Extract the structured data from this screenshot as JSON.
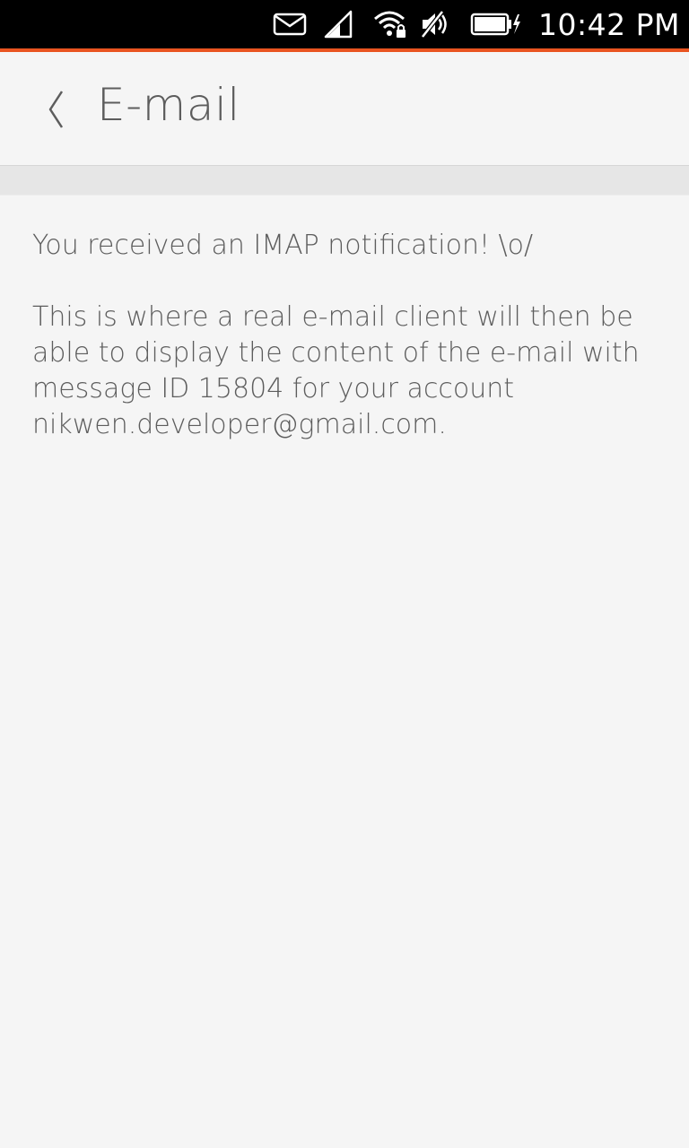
{
  "status_bar": {
    "time": "10:42 PM",
    "icons": [
      "mail-icon",
      "signal-icon",
      "wifi-lock-icon",
      "mute-icon",
      "battery-charging-icon"
    ]
  },
  "colors": {
    "status_bar_bg": "#000000",
    "accent": "#e95420",
    "page_bg": "#f5f5f5",
    "text": "#5d5d5d"
  },
  "header": {
    "back_icon": "chevron-left-icon",
    "title": "E-mail"
  },
  "message": {
    "line1": "You received an IMAP notification! \\o/",
    "body": "This is where a real e-mail client will then be able to display the content of the e-mail with message ID 15804 for your account nikwen.developer@gmail.com."
  }
}
